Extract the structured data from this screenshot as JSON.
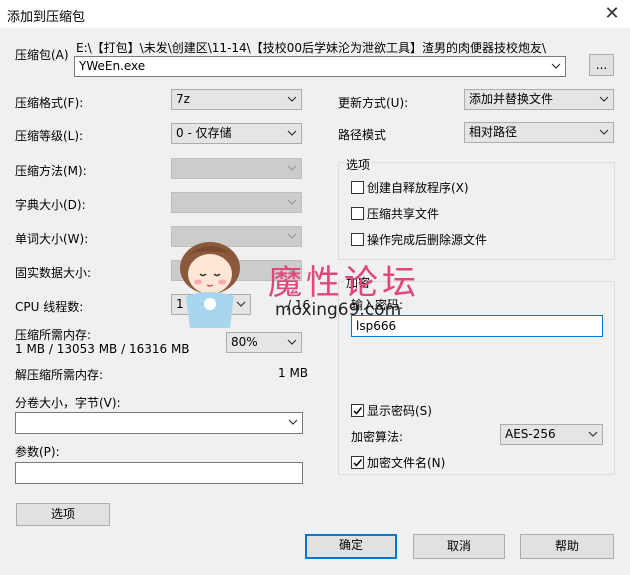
{
  "window": {
    "title": "添加到压缩包",
    "close_glyph": "✕"
  },
  "archive": {
    "label": "压缩包(A)",
    "path": "E:\\【打包】\\未发\\创建区\\11-14\\【技校00后学妹沦为泄欲工具】渣男的肉便器技校炮友\\",
    "filename": "YWeEn.exe",
    "browse_label": "..."
  },
  "left": {
    "format_label": "压缩格式(F):",
    "format_value": "7z",
    "level_label": "压缩等级(L):",
    "level_value": "0 - 仅存储",
    "method_label": "压缩方法(M):",
    "dict_label": "字典大小(D):",
    "word_label": "单词大小(W):",
    "solid_label": "固实数据大小:",
    "threads_label": "CPU 线程数:",
    "threads_value": "1",
    "threads_max": "/ 16",
    "mem_label": "压缩所需内存:",
    "mem_detail": "1 MB / 13053 MB / 16316 MB",
    "mem_percent": "80%",
    "decomp_label": "解压缩所需内存:",
    "decomp_value": "1 MB",
    "volume_label": "分卷大小，字节(V):",
    "volume_value": "",
    "params_label": "参数(P):",
    "params_value": "",
    "options_button": "选项"
  },
  "right": {
    "update_label": "更新方式(U):",
    "update_value": "添加并替换文件",
    "path_label": "路径模式",
    "path_value": "相对路径",
    "options_group": "选项",
    "opt_sfx": "创建自释放程序(X)",
    "opt_sfx_checked": false,
    "opt_shared": "压缩共享文件",
    "opt_shared_checked": false,
    "opt_delete": "操作完成后删除源文件",
    "opt_delete_checked": false,
    "enc_group": "加密",
    "password_label": "输入密码:",
    "password_value": "lsp666",
    "show_pw": "显示密码(S)",
    "show_pw_checked": true,
    "enc_method_label": "加密算法:",
    "enc_method_value": "AES-256",
    "enc_names": "加密文件名(N)",
    "enc_names_checked": true
  },
  "buttons": {
    "ok": "确定",
    "cancel": "取消",
    "help": "帮助"
  },
  "watermark": {
    "text": "魔性论坛",
    "url": "moxing69.com"
  }
}
